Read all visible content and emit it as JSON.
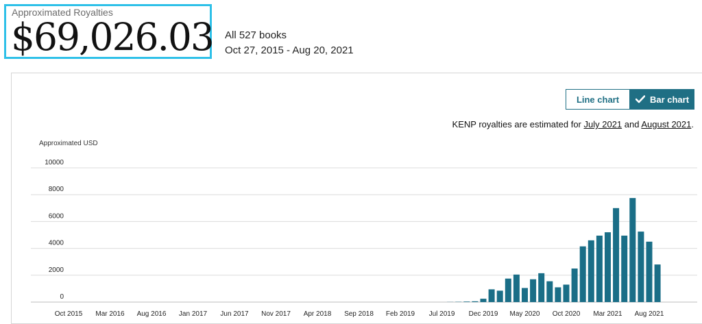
{
  "header": {
    "label": "Approximated Royalties",
    "amount": "$69,026.03",
    "books": "All 527 books",
    "date_range": "Oct 27, 2015 - Aug 20, 2021"
  },
  "toggle": {
    "line_label": "Line chart",
    "bar_label": "Bar chart",
    "selected": "bar"
  },
  "note": {
    "prefix": "KENP royalties are estimated for ",
    "link1": "July 2021",
    "middle": " and ",
    "link2": "August 2021",
    "suffix": "."
  },
  "colors": {
    "accent": "#2ec0e8",
    "bar": "#1a6e87",
    "toggle": "#1f6f84"
  },
  "chart_data": {
    "type": "bar",
    "ylabel": "Approximated USD",
    "ylim": [
      0,
      10000
    ],
    "yticks": [
      0,
      2000,
      4000,
      6000,
      8000,
      10000
    ],
    "x_tick_labels": [
      {
        "label": "Oct 2015",
        "index": 0
      },
      {
        "label": "Mar 2016",
        "index": 5
      },
      {
        "label": "Aug 2016",
        "index": 10
      },
      {
        "label": "Jan 2017",
        "index": 15
      },
      {
        "label": "Jun 2017",
        "index": 20
      },
      {
        "label": "Nov 2017",
        "index": 25
      },
      {
        "label": "Apr 2018",
        "index": 30
      },
      {
        "label": "Sep 2018",
        "index": 35
      },
      {
        "label": "Feb 2019",
        "index": 40
      },
      {
        "label": "Jul 2019",
        "index": 45
      },
      {
        "label": "Dec 2019",
        "index": 50
      },
      {
        "label": "May 2020",
        "index": 55
      },
      {
        "label": "Oct 2020",
        "index": 60
      },
      {
        "label": "Mar 2021",
        "index": 65
      },
      {
        "label": "Aug 2021",
        "index": 70
      }
    ],
    "categories": [
      "Oct 2015",
      "Nov 2015",
      "Dec 2015",
      "Jan 2016",
      "Feb 2016",
      "Mar 2016",
      "Apr 2016",
      "May 2016",
      "Jun 2016",
      "Jul 2016",
      "Aug 2016",
      "Sep 2016",
      "Oct 2016",
      "Nov 2016",
      "Dec 2016",
      "Jan 2017",
      "Feb 2017",
      "Mar 2017",
      "Apr 2017",
      "May 2017",
      "Jun 2017",
      "Jul 2017",
      "Aug 2017",
      "Sep 2017",
      "Oct 2017",
      "Nov 2017",
      "Dec 2017",
      "Jan 2018",
      "Feb 2018",
      "Mar 2018",
      "Apr 2018",
      "May 2018",
      "Jun 2018",
      "Jul 2018",
      "Aug 2018",
      "Sep 2018",
      "Oct 2018",
      "Nov 2018",
      "Dec 2018",
      "Jan 2019",
      "Feb 2019",
      "Mar 2019",
      "Apr 2019",
      "May 2019",
      "Jun 2019",
      "Jul 2019",
      "Aug 2019",
      "Sep 2019",
      "Oct 2019",
      "Nov 2019",
      "Dec 2019",
      "Jan 2020",
      "Feb 2020",
      "Mar 2020",
      "Apr 2020",
      "May 2020",
      "Jun 2020",
      "Jul 2020",
      "Aug 2020",
      "Sep 2020",
      "Oct 2020",
      "Nov 2020",
      "Dec 2020",
      "Jan 2021",
      "Feb 2021",
      "Mar 2021",
      "Apr 2021",
      "May 2021",
      "Jun 2021",
      "Jul 2021",
      "Aug 2021"
    ],
    "values": [
      0,
      0,
      0,
      0,
      0,
      0,
      0,
      0,
      0,
      0,
      0,
      0,
      0,
      0,
      0,
      0,
      0,
      0,
      0,
      0,
      0,
      0,
      0,
      0,
      0,
      0,
      0,
      0,
      0,
      0,
      0,
      0,
      0,
      0,
      0,
      0,
      0,
      0,
      0,
      0,
      0,
      0,
      0,
      0,
      0,
      0,
      10,
      20,
      40,
      60,
      250,
      950,
      850,
      1750,
      2050,
      1050,
      1700,
      2150,
      1550,
      1100,
      1300,
      2500,
      4150,
      4600,
      4950,
      5200,
      7000,
      4950,
      7750,
      5250,
      4500,
      2800
    ]
  }
}
